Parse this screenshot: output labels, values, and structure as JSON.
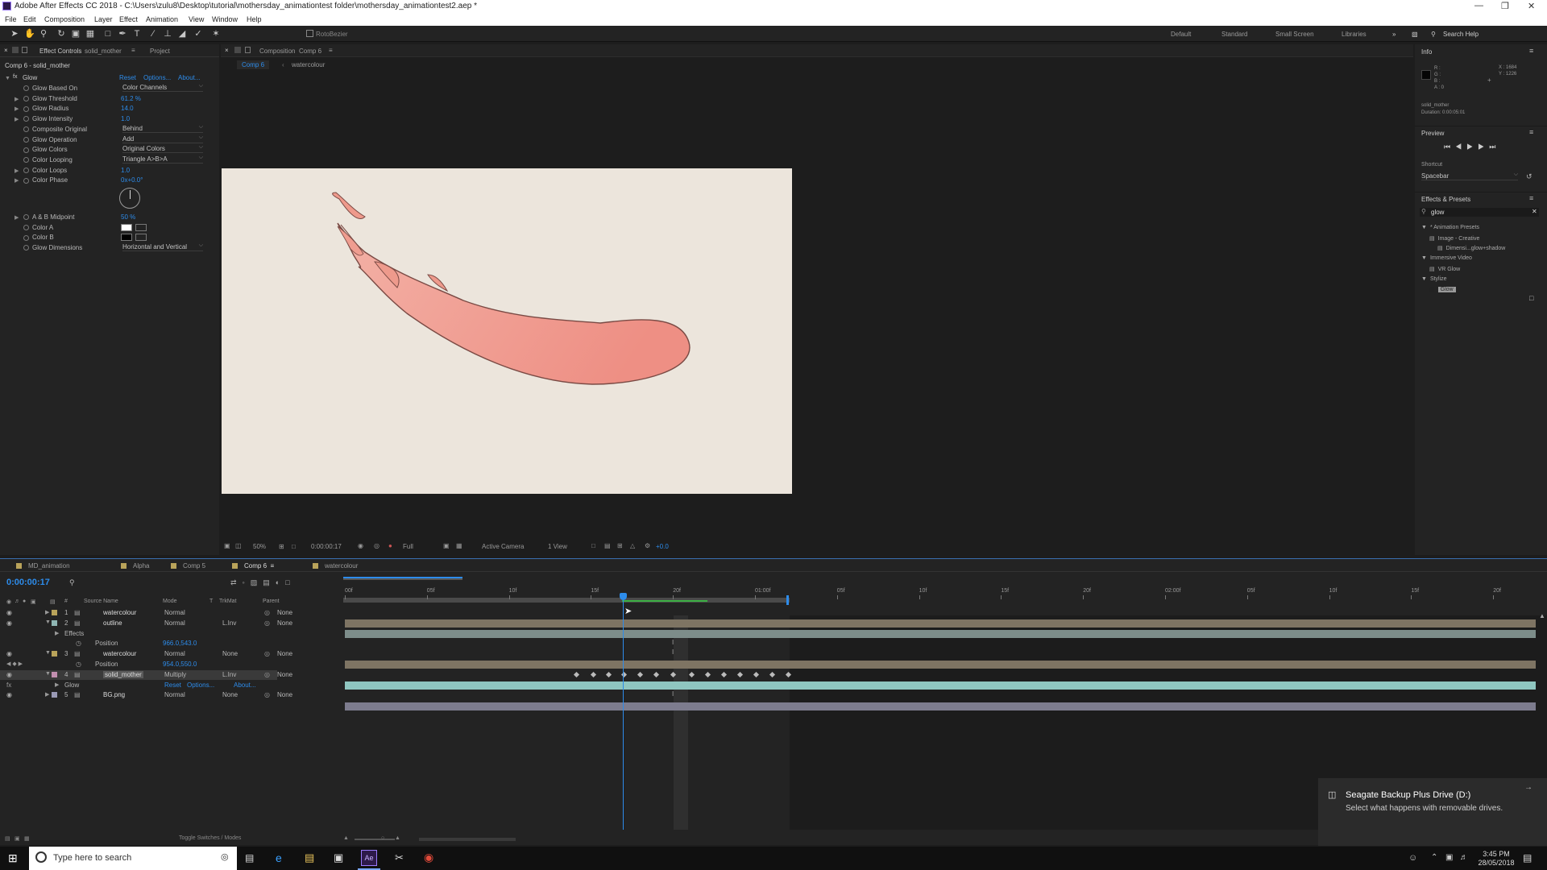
{
  "window": {
    "title": "Adobe After Effects CC 2018 - C:\\Users\\zulu8\\Desktop\\tutorial\\mothersday_animationtest folder\\mothersday_animationtest2.aep *"
  },
  "menu": [
    "File",
    "Edit",
    "Composition",
    "Layer",
    "Effect",
    "Animation",
    "View",
    "Window",
    "Help"
  ],
  "toolbar": {
    "rotobezier": "RotoBezier",
    "workspaces": [
      "Default",
      "Standard",
      "Small Screen",
      "Libraries"
    ],
    "search_help": "Search Help"
  },
  "effect_controls": {
    "tab_label": "Effect Controls",
    "tab_layer": "solid_mother",
    "tab_project": "Project",
    "header": "Comp 6 - solid_mother",
    "effect_name": "Glow",
    "reset": "Reset",
    "options": "Options...",
    "about": "About...",
    "props": [
      {
        "name": "Glow Based On",
        "value": "Color Channels",
        "type": "dropdown"
      },
      {
        "name": "Glow Threshold",
        "value": "61.2 %",
        "type": "value"
      },
      {
        "name": "Glow Radius",
        "value": "14.0",
        "type": "value"
      },
      {
        "name": "Glow Intensity",
        "value": "1.0",
        "type": "value"
      },
      {
        "name": "Composite Original",
        "value": "Behind",
        "type": "dropdown"
      },
      {
        "name": "Glow Operation",
        "value": "Add",
        "type": "dropdown"
      },
      {
        "name": "Glow Colors",
        "value": "Original Colors",
        "type": "dropdown"
      },
      {
        "name": "Color Looping",
        "value": "Triangle A>B>A",
        "type": "dropdown"
      },
      {
        "name": "Color Loops",
        "value": "1.0",
        "type": "value"
      },
      {
        "name": "Color Phase",
        "value": "0x+0.0°",
        "type": "value"
      }
    ],
    "props2": [
      {
        "name": "A & B Midpoint",
        "value": "50 %",
        "type": "value"
      },
      {
        "name": "Color A",
        "value": "",
        "type": "color"
      },
      {
        "name": "Color B",
        "value": "",
        "type": "color"
      },
      {
        "name": "Glow Dimensions",
        "value": "Horizontal and Vertical",
        "type": "dropdown"
      }
    ]
  },
  "composition": {
    "panel_label": "Composition",
    "comp_name": "Comp 6",
    "breadcrumb": [
      "Comp 6",
      "watercolour"
    ],
    "footer": {
      "zoom": "50%",
      "timecode": "0:00:00:17",
      "resolution": "Full",
      "camera": "Active Camera",
      "view": "1 View",
      "exposure": "+0.0"
    }
  },
  "info": {
    "title": "Info",
    "r": "R :",
    "g": "G :",
    "b": "B :",
    "a": "A : 0",
    "x": "X : 1684",
    "y": "Y : 1226",
    "layer": "solid_mother",
    "duration": "Duration: 0:00:05:01"
  },
  "preview": {
    "title": "Preview",
    "shortcut_label": "Shortcut",
    "shortcut": "Spacebar"
  },
  "effects_presets": {
    "title": "Effects & Presets",
    "search": "glow",
    "tree": [
      {
        "label": "* Animation Presets",
        "level": 0
      },
      {
        "label": "Image - Creative",
        "level": 1
      },
      {
        "label": "Dimensi...glow+shadow",
        "level": 2
      },
      {
        "label": "Immersive Video",
        "level": 0
      },
      {
        "label": "VR Glow",
        "level": 1
      },
      {
        "label": "Stylize",
        "level": 0
      },
      {
        "label": "Glow",
        "level": 1
      }
    ]
  },
  "timeline": {
    "tabs": [
      "MD_animation",
      "Alpha",
      "Comp 5",
      "Comp 6",
      "watercolour"
    ],
    "timecode": "0:00:00:17",
    "columns": {
      "num": "#",
      "source": "Source Name",
      "mode": "Mode",
      "t": "T",
      "trkmat": "TrkMat",
      "parent": "Parent"
    },
    "rows": [
      {
        "num": "1",
        "name": "watercolour",
        "mode": "Normal",
        "trk": "",
        "parent": "None",
        "kind": "layer"
      },
      {
        "num": "2",
        "name": "outline",
        "mode": "Normal",
        "trk": "L.Inv",
        "parent": "None",
        "kind": "layer"
      },
      {
        "num": "",
        "name": "Effects",
        "mode": "",
        "trk": "",
        "parent": "",
        "kind": "sub"
      },
      {
        "num": "",
        "name": "Position",
        "mode": "966.0,543.0",
        "trk": "",
        "parent": "",
        "kind": "prop"
      },
      {
        "num": "3",
        "name": "watercolour",
        "mode": "Normal",
        "trk": "None",
        "parent": "None",
        "kind": "layer"
      },
      {
        "num": "",
        "name": "Position",
        "mode": "954.0,550.0",
        "trk": "",
        "parent": "",
        "kind": "prop"
      },
      {
        "num": "4",
        "name": "solid_mother",
        "mode": "Multiply",
        "trk": "L.Inv",
        "parent": "None",
        "kind": "layer"
      },
      {
        "num": "",
        "name": "Glow",
        "mode": "Reset",
        "trk": "Options...",
        "parent": "About...",
        "kind": "sub"
      },
      {
        "num": "5",
        "name": "BG.png",
        "mode": "Normal",
        "trk": "None",
        "parent": "None",
        "kind": "layer"
      }
    ],
    "ruler": [
      "00f",
      "05f",
      "10f",
      "15f",
      "20f",
      "01:00f",
      "05f",
      "10f",
      "15f",
      "20f",
      "02:00f",
      "05f",
      "10f",
      "15f",
      "20f"
    ],
    "footer": "Toggle Switches / Modes"
  },
  "notification": {
    "title": "Seagate Backup Plus Drive (D:)",
    "body": "Select what happens with removable drives."
  },
  "taskbar": {
    "search": "Type here to search",
    "time": "3:45 PM",
    "date": "28/05/2018"
  }
}
